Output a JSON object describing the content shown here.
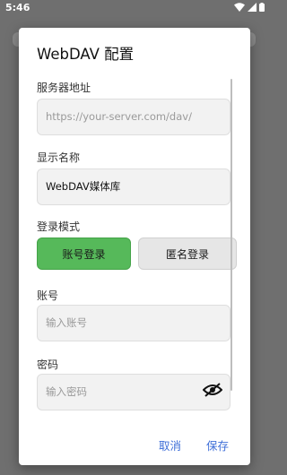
{
  "status_bar": {
    "time": "5:46"
  },
  "dialog": {
    "title": "WebDAV 配置",
    "server": {
      "label": "服务器地址",
      "placeholder": "https://your-server.com/dav/"
    },
    "display_name": {
      "label": "显示名称",
      "value": "WebDAV媒体库"
    },
    "login_mode": {
      "label": "登录模式",
      "options": [
        "账号登录",
        "匿名登录"
      ],
      "selected": "账号登录"
    },
    "account": {
      "label": "账号",
      "placeholder": "输入账号"
    },
    "password": {
      "label": "密码",
      "placeholder": "输入密码",
      "toggle_icon": "visibility-off-icon"
    },
    "actions": {
      "cancel": "取消",
      "save": "保存"
    }
  },
  "colors": {
    "accent": "#3f6fd8",
    "active_mode": "#56b95a",
    "scrim": "#6f6f6f"
  }
}
